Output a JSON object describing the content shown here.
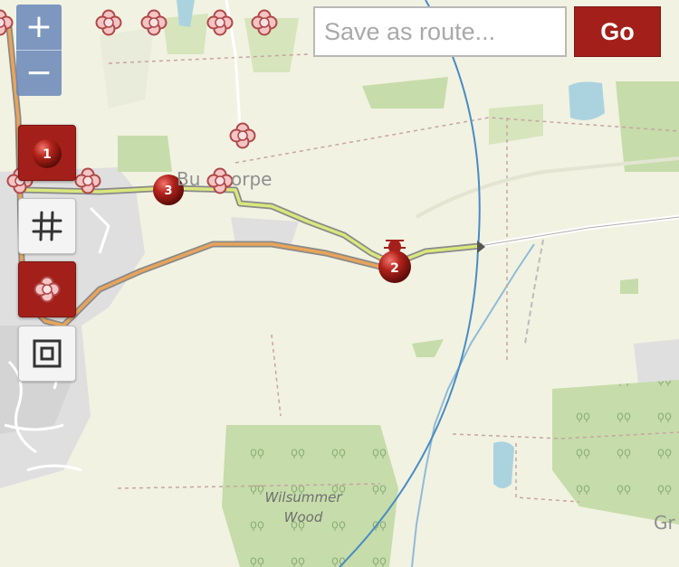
{
  "map": {
    "labels": {
      "village_partial": "Bu",
      "village_partial_2": "orpe",
      "wood_line1": "Wilsummer",
      "wood_line2": "Wood",
      "edge_place_partial": "Gr"
    },
    "waypoints": [
      "1",
      "2",
      "3"
    ],
    "colors": {
      "background": "#f1f2e2",
      "woodland": "#c6dcaa",
      "water": "#abd3df",
      "route_gpx": "#e8a45a",
      "route_planned": "#d9e77c",
      "accent_red": "#a3201a",
      "zoom_blue": "#6987b9",
      "circle_line": "#4a8bc2"
    }
  },
  "controls": {
    "zoom_in_label": "+",
    "zoom_out_label": "−",
    "route_name_placeholder": "Save as route...",
    "go_label": "Go",
    "icons": [
      "waypoint-marker-icon",
      "grid-icon",
      "flower-poi-icon",
      "frame-icon"
    ]
  }
}
